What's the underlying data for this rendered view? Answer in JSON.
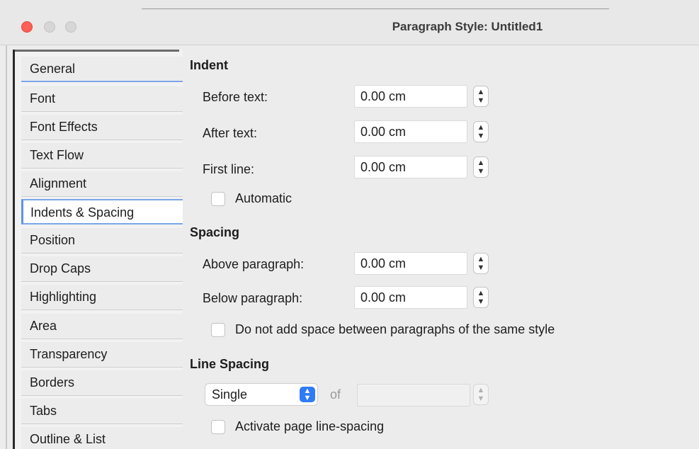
{
  "window": {
    "title": "Paragraph Style: Untitled1"
  },
  "sidebar": {
    "selected": "Indents & Spacing",
    "items": [
      {
        "label": "General"
      },
      {
        "label": "Font"
      },
      {
        "label": "Font Effects"
      },
      {
        "label": "Text Flow"
      },
      {
        "label": "Alignment"
      },
      {
        "label": "Indents & Spacing"
      },
      {
        "label": "Position"
      },
      {
        "label": "Drop Caps"
      },
      {
        "label": "Highlighting"
      },
      {
        "label": "Area"
      },
      {
        "label": "Transparency"
      },
      {
        "label": "Borders"
      },
      {
        "label": "Tabs"
      },
      {
        "label": "Outline & List"
      }
    ]
  },
  "indent": {
    "title": "Indent",
    "before_text_label": "Before text:",
    "before_text_value": "0.00 cm",
    "after_text_label": "After text:",
    "after_text_value": "0.00 cm",
    "first_line_label": "First line:",
    "first_line_value": "0.00 cm",
    "automatic_label": "Automatic",
    "automatic_checked": false
  },
  "spacing": {
    "title": "Spacing",
    "above_label": "Above paragraph:",
    "above_value": "0.00 cm",
    "below_label": "Below paragraph:",
    "below_value": "0.00 cm",
    "no_space_label": "Do not add space between paragraphs of the same style",
    "no_space_checked": false
  },
  "line_spacing": {
    "title": "Line Spacing",
    "mode": "Single",
    "of_label": "of",
    "of_value": "",
    "page_line_spacing_label": "Activate page line-spacing",
    "page_line_spacing_checked": false
  },
  "colors": {
    "accent": "#2f7bf5",
    "selection_border": "#7aa7e9",
    "close_button": "#fe5f57"
  },
  "icons": {
    "spinner": "up-down-chevron-icon",
    "select": "chevron-updown-icon"
  }
}
